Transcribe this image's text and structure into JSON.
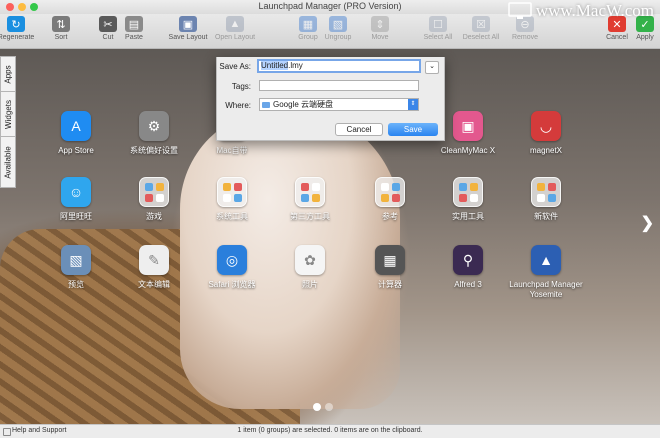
{
  "window": {
    "title": "Launchpad Manager (PRO Version)",
    "watermark": "www.MacW.com"
  },
  "toolbar": {
    "items": [
      {
        "label": "Regenerate",
        "icon": "regenerate-icon",
        "color": "#1a8fe0",
        "glyph": "↻",
        "enabled": true
      },
      {
        "label": "Sort",
        "icon": "sort-icon",
        "color": "#7a7a7a",
        "glyph": "⇅",
        "enabled": true
      },
      {
        "label": "Cut",
        "icon": "scissors-icon",
        "color": "#5a5a5a",
        "glyph": "✂",
        "enabled": true
      },
      {
        "label": "Paste",
        "icon": "paste-icon",
        "color": "#8a8a8a",
        "glyph": "▤",
        "enabled": true
      },
      {
        "label": "Save Layout",
        "icon": "save-layout-icon",
        "color": "#6c84b0",
        "glyph": "▣",
        "enabled": true
      },
      {
        "label": "Open Layout",
        "icon": "open-layout-icon",
        "color": "#8f9aad",
        "glyph": "▲",
        "enabled": false
      },
      {
        "label": "Group",
        "icon": "group-icon",
        "color": "#3d7bd0",
        "glyph": "▦",
        "enabled": false
      },
      {
        "label": "Ungroup",
        "icon": "ungroup-icon",
        "color": "#3d7bd0",
        "glyph": "▧",
        "enabled": false
      },
      {
        "label": "Move",
        "icon": "move-icon",
        "color": "#9a9a9a",
        "glyph": "⇕",
        "enabled": false
      },
      {
        "label": "Select All",
        "icon": "select-all-icon",
        "color": "#9aa4b5",
        "glyph": "☐",
        "enabled": false
      },
      {
        "label": "Deselect All",
        "icon": "deselect-all-icon",
        "color": "#9aa4b5",
        "glyph": "☒",
        "enabled": false
      },
      {
        "label": "Remove",
        "icon": "remove-icon",
        "color": "#9aa4b5",
        "glyph": "⊖",
        "enabled": false
      },
      {
        "label": "Cancel",
        "icon": "cancel-icon",
        "color": "#e03c31",
        "glyph": "✕",
        "enabled": true
      },
      {
        "label": "Apply",
        "icon": "apply-icon",
        "color": "#33b24a",
        "glyph": "✓",
        "enabled": true
      }
    ]
  },
  "sidebar": {
    "tabs": [
      {
        "label": "Apps"
      },
      {
        "label": "Widgets"
      },
      {
        "label": "Available"
      }
    ]
  },
  "grid": {
    "apps": [
      {
        "label": "App Store",
        "icon": "app-store-icon",
        "color": "#1f8cf2",
        "glyph": "A",
        "folder": false
      },
      {
        "label": "系统偏好设置",
        "icon": "system-preferences-icon",
        "color": "#888888",
        "glyph": "⚙",
        "folder": false
      },
      {
        "label": "Mac自带",
        "icon": "folder-icon",
        "color": "#bbbbbb",
        "glyph": "",
        "folder": true
      },
      {
        "label": "CleanMyMac X",
        "icon": "cleanmymac-icon",
        "color": "#e3588e",
        "glyph": "▣",
        "folder": false
      },
      {
        "label": "magnetX",
        "icon": "magnet-icon",
        "color": "#d43b3b",
        "glyph": "◡",
        "folder": false
      },
      {
        "label": "阿里旺旺",
        "icon": "aliwangwang-icon",
        "color": "#2fa6ee",
        "glyph": "☺",
        "folder": false
      },
      {
        "label": "游戏",
        "icon": "folder-icon",
        "color": "#bbbbbb",
        "glyph": "",
        "folder": true
      },
      {
        "label": "系统工具",
        "icon": "folder-icon",
        "color": "#bbbbbb",
        "glyph": "",
        "folder": true
      },
      {
        "label": "第三方工具",
        "icon": "folder-icon",
        "color": "#bbbbbb",
        "glyph": "",
        "folder": true
      },
      {
        "label": "参考",
        "icon": "folder-icon",
        "color": "#bbbbbb",
        "glyph": "",
        "folder": true
      },
      {
        "label": "实用工具",
        "icon": "folder-icon",
        "color": "#bbbbbb",
        "glyph": "",
        "folder": true
      },
      {
        "label": "新软件",
        "icon": "folder-icon",
        "color": "#bbbbbb",
        "glyph": "",
        "folder": true
      },
      {
        "label": "预览",
        "icon": "preview-icon",
        "color": "#6b8fb8",
        "glyph": "▧",
        "folder": false
      },
      {
        "label": "文本编辑",
        "icon": "textedit-icon",
        "color": "#eeeeee",
        "glyph": "✎",
        "folder": false
      },
      {
        "label": "Safari 浏览器",
        "icon": "safari-icon",
        "color": "#2a7fdc",
        "glyph": "◎",
        "folder": false
      },
      {
        "label": "照片",
        "icon": "photos-icon",
        "color": "#f5f5f5",
        "glyph": "✿",
        "folder": false
      },
      {
        "label": "计算器",
        "icon": "calculator-icon",
        "color": "#555555",
        "glyph": "▦",
        "folder": false
      },
      {
        "label": "Alfred 3",
        "icon": "alfred-icon",
        "color": "#3b2a52",
        "glyph": "⚲",
        "folder": false
      },
      {
        "label": "Launchpad Manager Yosemite",
        "icon": "rocket-icon",
        "color": "#2c5fb3",
        "glyph": "▲",
        "folder": false
      }
    ]
  },
  "save_dialog": {
    "save_as_label": "Save As:",
    "filename_selected": "Untitled",
    "filename_ext": ".lmy",
    "tags_label": "Tags:",
    "tags_value": "",
    "where_label": "Where:",
    "where_value": "Google 云端硬盘",
    "cancel_label": "Cancel",
    "save_label": "Save"
  },
  "status": {
    "help": "Help and Support",
    "message": "1 item (0 groups) are selected. 0 items are on the clipboard."
  }
}
